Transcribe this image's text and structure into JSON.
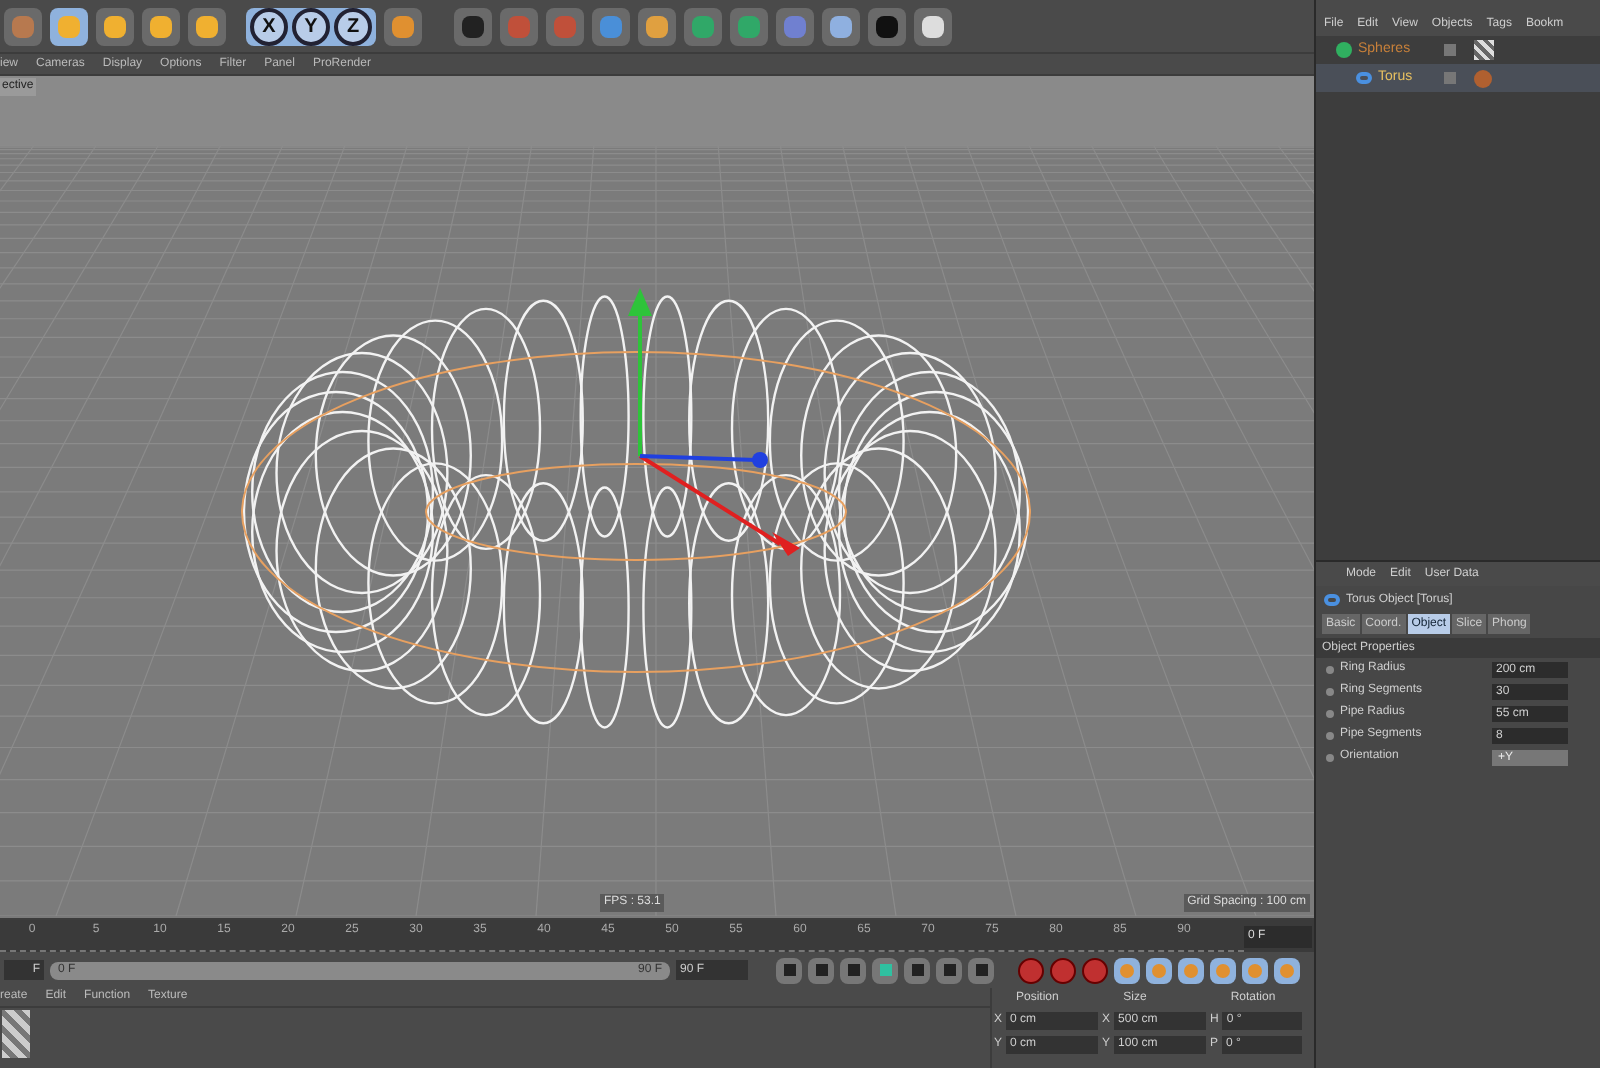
{
  "toolbar": {
    "axis_buttons": [
      {
        "label": "X",
        "selected": true
      },
      {
        "label": "Y",
        "selected": true
      },
      {
        "label": "Z",
        "selected": true
      }
    ]
  },
  "viewport_menu": [
    "iew",
    "Cameras",
    "Display",
    "Options",
    "Filter",
    "Panel",
    "ProRender"
  ],
  "viewport": {
    "title": "ective",
    "fps": "FPS : 53.1",
    "grid_spacing": "Grid Spacing : 100 cm"
  },
  "timeline": {
    "ticks": [
      "0",
      "5",
      "10",
      "15",
      "20",
      "25",
      "30",
      "35",
      "40",
      "45",
      "50",
      "55",
      "60",
      "65",
      "70",
      "75",
      "80",
      "85",
      "90"
    ],
    "current_frame": "0 F",
    "range_start_field": "F",
    "range": {
      "level": 1,
      "start": "0 F",
      "end": "90 F"
    },
    "end_field": "90 F"
  },
  "material_menu": [
    "reate",
    "Edit",
    "Function",
    "Texture"
  ],
  "coordinates": {
    "headers": [
      "Position",
      "Size",
      "Rotation"
    ],
    "rows": [
      {
        "axis": "X",
        "position": "0 cm",
        "size_axis": "X",
        "size": "500 cm",
        "rot_axis": "H",
        "rotation": "0 °"
      },
      {
        "axis": "Y",
        "position": "0 cm",
        "size_axis": "Y",
        "size": "100 cm",
        "rot_axis": "P",
        "rotation": "0 °"
      }
    ]
  },
  "object_manager": {
    "menu": [
      "File",
      "Edit",
      "View",
      "Objects",
      "Tags",
      "Bookm"
    ],
    "objects": [
      {
        "name": "Spheres",
        "selected": false,
        "children": [
          {
            "name": "Torus",
            "selected": true
          }
        ]
      }
    ]
  },
  "attributes": {
    "menu": [
      "Mode",
      "Edit",
      "User Data"
    ],
    "title": "Torus Object [Torus]",
    "tabs": [
      {
        "label": "Basic",
        "selected": false
      },
      {
        "label": "Coord.",
        "selected": false
      },
      {
        "label": "Object",
        "selected": true
      },
      {
        "label": "Slice",
        "selected": false
      },
      {
        "label": "Phong",
        "selected": false
      }
    ],
    "section": "Object Properties",
    "fields": [
      {
        "kind": "number",
        "label": "Ring Radius",
        "value": "200 cm"
      },
      {
        "kind": "number",
        "label": "Ring Segments",
        "value": "30"
      },
      {
        "kind": "number",
        "label": "Pipe Radius",
        "value": "55 cm"
      },
      {
        "kind": "number",
        "label": "Pipe Segments",
        "value": "8"
      },
      {
        "kind": "dropdown",
        "label": "Orientation",
        "value": "+Y"
      }
    ]
  }
}
